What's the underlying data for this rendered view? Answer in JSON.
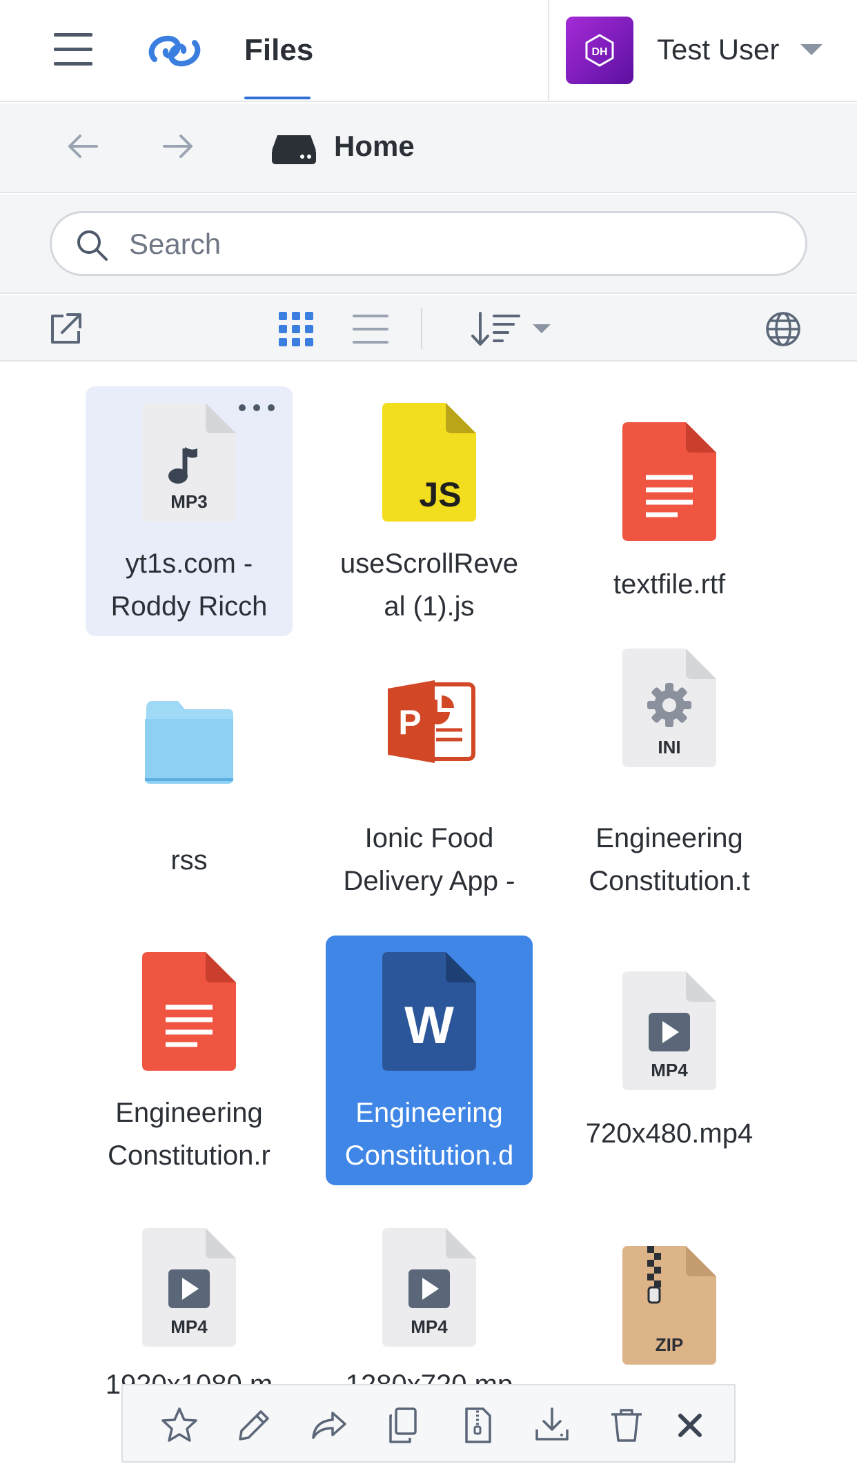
{
  "app": {
    "tab_files": "Files",
    "user_name": "Test User",
    "colors": {
      "accent": "#2f6fd6",
      "selected_tile": "#3f86e6",
      "selected_tile_light": "#e8edf9",
      "avatar": "#9b26d0"
    }
  },
  "nav": {
    "location": "Home",
    "back_icon": "arrow-left-icon",
    "forward_icon": "arrow-right-icon",
    "drive_icon": "drive-icon"
  },
  "search": {
    "placeholder": "Search",
    "value": ""
  },
  "toolbar": {
    "items": [
      "open-external-icon",
      "grid-view-icon",
      "list-view-icon",
      "sort-icon",
      "globe-icon"
    ],
    "active_view": "grid"
  },
  "files": [
    {
      "name": "yt1s.com - Roddy Ricch",
      "type": "MP3",
      "selected": "hover"
    },
    {
      "name": "useScrollReveal (1).js",
      "type": "JS",
      "selected": "none"
    },
    {
      "name": "textfile.rtf",
      "type": "RTF",
      "selected": "none"
    },
    {
      "name": "rss",
      "type": "FOLDER",
      "selected": "none"
    },
    {
      "name": "Ionic Food Delivery App -",
      "type": "PPT",
      "selected": "none"
    },
    {
      "name": "Engineering Constitution.t",
      "type": "INI",
      "selected": "none"
    },
    {
      "name": "Engineering Constitution.r",
      "type": "RTF",
      "selected": "none"
    },
    {
      "name": "Engineering Constitution.d",
      "type": "DOC",
      "selected": "active"
    },
    {
      "name": "720x480.mp4",
      "type": "MP4",
      "selected": "none"
    },
    {
      "name": "1920x1080.m",
      "type": "MP4",
      "selected": "none"
    },
    {
      "name": "1280x720.mp",
      "type": "MP4",
      "selected": "none"
    },
    {
      "name": "",
      "type": "ZIP",
      "selected": "none"
    }
  ],
  "file_names": {
    "f0": [
      "yt1s.com -",
      "Roddy Ricch"
    ],
    "f1": [
      "useScrollReve",
      "al (1).js"
    ],
    "f2": [
      "textfile.rtf"
    ],
    "f3": [
      "rss"
    ],
    "f4": [
      "Ionic Food",
      "Delivery App -"
    ],
    "f5": [
      "Engineering",
      "Constitution.t"
    ],
    "f6": [
      "Engineering",
      "Constitution.r"
    ],
    "f7": [
      "Engineering",
      "Constitution.d"
    ],
    "f8": [
      "720x480.mp4"
    ],
    "f9": [
      "1920x1080.m"
    ],
    "f10": [
      "1280x720.mp"
    ]
  },
  "badges": {
    "mp3": "MP3",
    "js": "JS",
    "ini": "INI",
    "mp4": "MP4",
    "zip": "ZIP",
    "ppt": "P",
    "doc": "W"
  },
  "actions": [
    "star-icon",
    "rename-pencil-icon",
    "share-icon",
    "copy-icon",
    "zip-file-icon",
    "download-icon",
    "trash-icon",
    "close-icon"
  ]
}
